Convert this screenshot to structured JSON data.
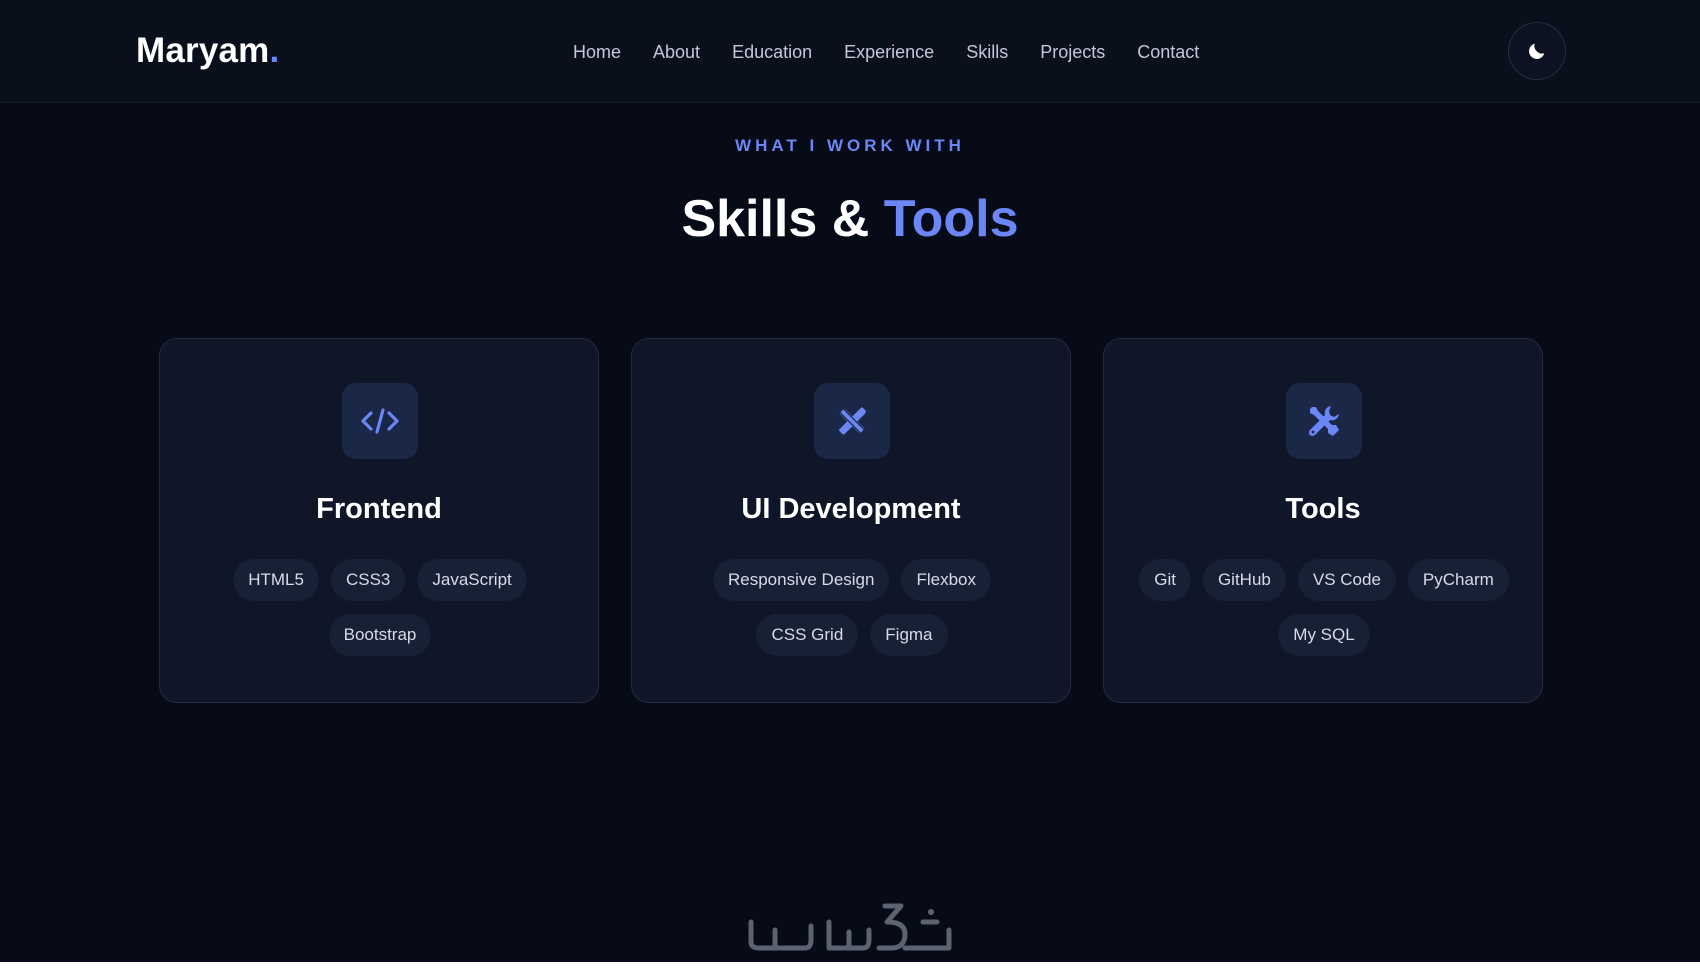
{
  "header": {
    "logo_text": "Maryam",
    "logo_dot": ".",
    "nav": [
      {
        "label": "Home"
      },
      {
        "label": "About"
      },
      {
        "label": "Education"
      },
      {
        "label": "Experience"
      },
      {
        "label": "Skills"
      },
      {
        "label": "Projects"
      },
      {
        "label": "Contact"
      }
    ],
    "theme_toggle_icon": "moon-icon"
  },
  "section": {
    "eyebrow": "WHAT I WORK WITH",
    "title_main": "Skills & ",
    "title_accent": "Tools"
  },
  "cards": [
    {
      "icon": "code-icon",
      "title": "Frontend",
      "tags": [
        "HTML5",
        "CSS3",
        "JavaScript",
        "Bootstrap"
      ]
    },
    {
      "icon": "design-tools-icon",
      "title": "UI Development",
      "tags": [
        "Responsive Design",
        "Flexbox",
        "CSS Grid",
        "Figma"
      ]
    },
    {
      "icon": "wrench-screwdriver-icon",
      "title": "Tools",
      "tags": [
        "Git",
        "GitHub",
        "VS Code",
        "PyCharm",
        "My SQL"
      ]
    }
  ],
  "watermark": {
    "text": "خمسات"
  },
  "colors": {
    "background": "#070b17",
    "card": "#0f1628",
    "accent": "#6b87f5",
    "tag_bg": "#182035"
  }
}
